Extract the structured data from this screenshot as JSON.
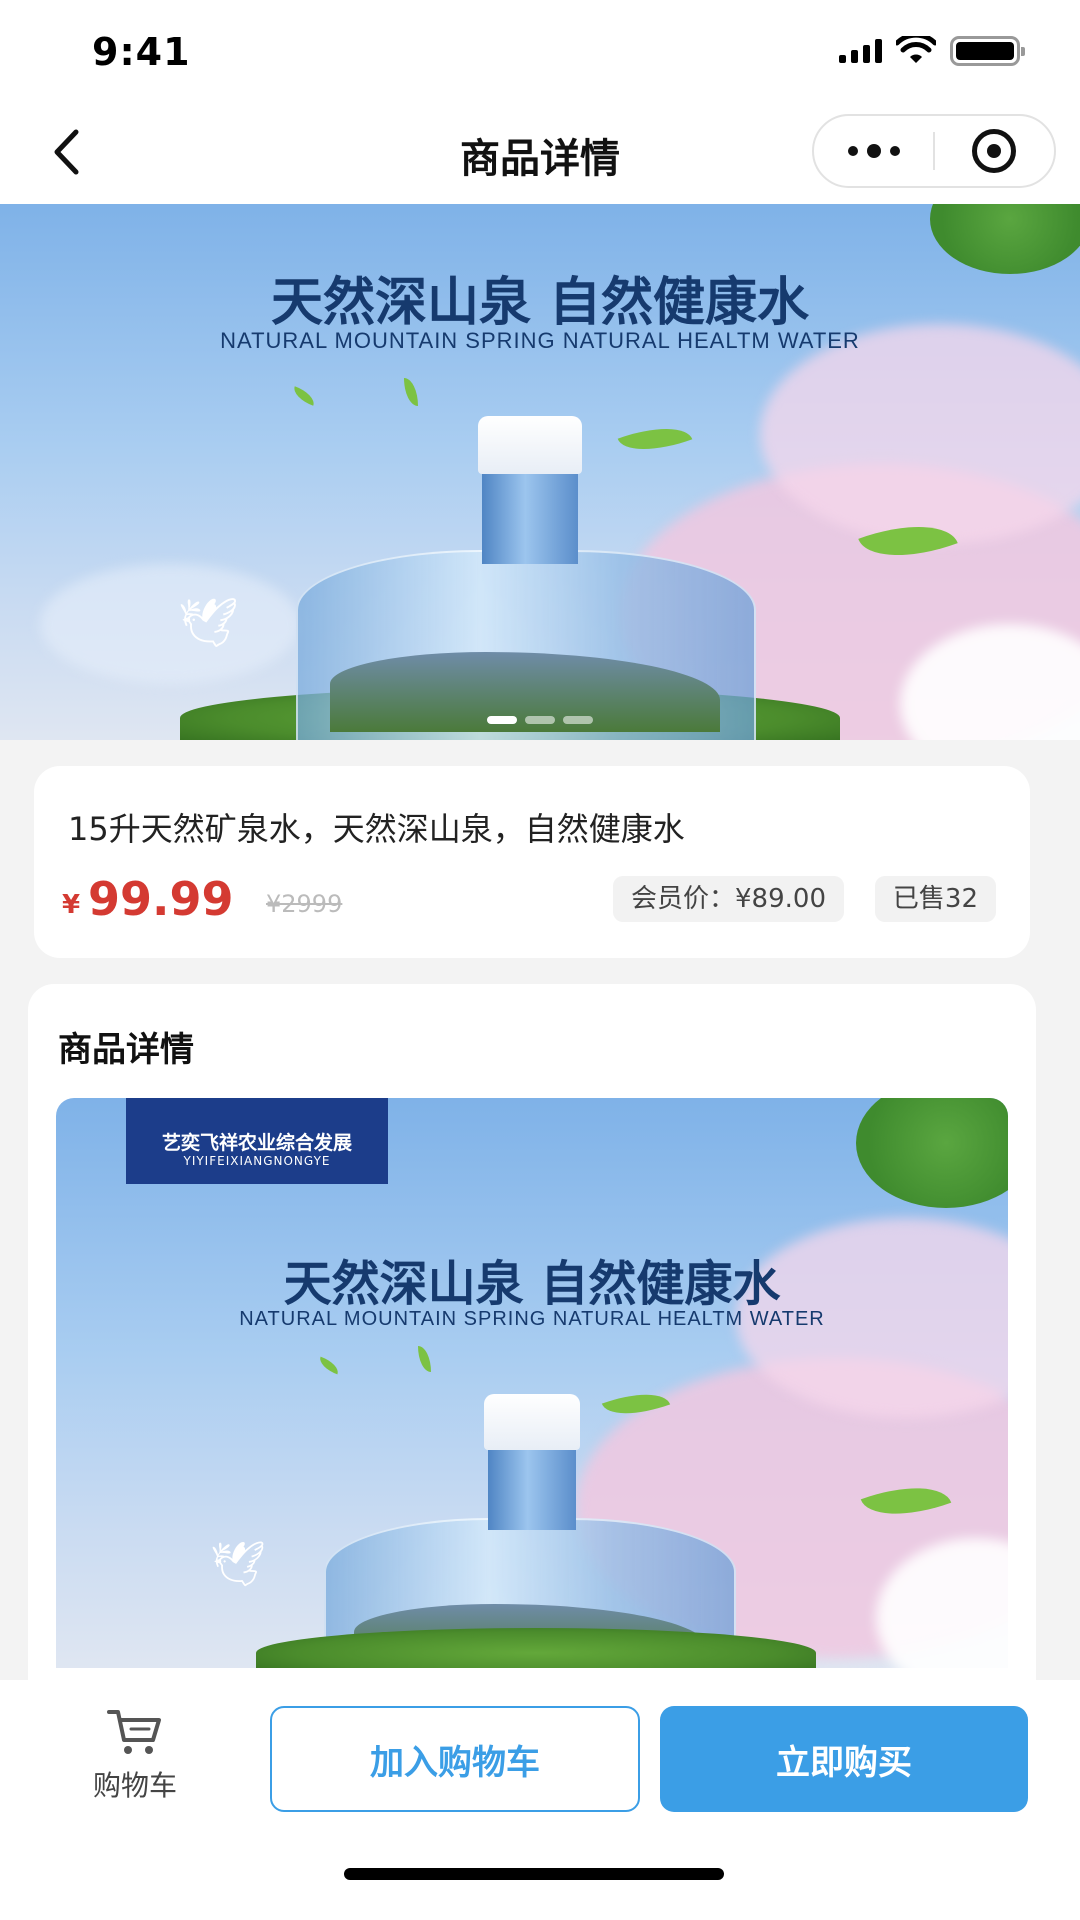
{
  "status_bar": {
    "time": "9:41"
  },
  "nav": {
    "title": "商品详情"
  },
  "banner": {
    "headline": "天然深山泉 自然健康水",
    "subline": "NATURAL MOUNTAIN SPRING NATURAL HEALTM WATER",
    "slide_count": 3,
    "active_slide": 1
  },
  "product": {
    "title": "15升天然矿泉水，天然深山泉，自然健康水",
    "price_symbol": "¥",
    "price": "99.99",
    "original_price": "¥2999",
    "member_price": "会员价：¥89.00",
    "sold": "已售32"
  },
  "detail": {
    "heading": "商品详情",
    "brand_cn": "艺奕飞祥农业综合发展",
    "brand_en": "YIYIFEIXIANGNONGYE",
    "headline": "天然深山泉 自然健康水",
    "subline": "NATURAL MOUNTAIN SPRING NATURAL HEALTM WATER"
  },
  "bottom_bar": {
    "cart_label": "购物车",
    "add_to_cart": "加入购物车",
    "buy_now": "立即购买"
  },
  "colors": {
    "accent": "#3b9ee6",
    "price": "#d43a32",
    "navy": "#163a6e"
  }
}
